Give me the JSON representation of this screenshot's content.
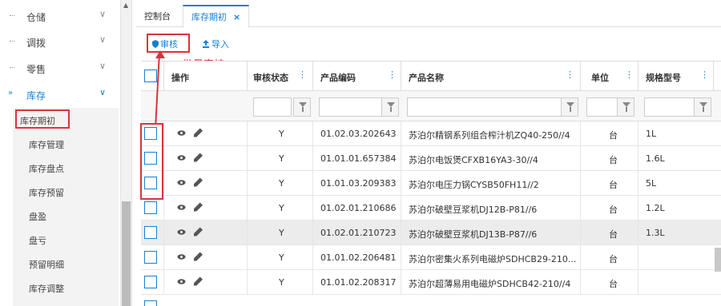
{
  "sidebar": {
    "menu": [
      {
        "label": "仓储",
        "chevron": "∨"
      },
      {
        "label": "调拨",
        "chevron": "∨"
      },
      {
        "label": "零售",
        "chevron": "∨"
      },
      {
        "label": "库存",
        "chevron": "∨",
        "arrow": "»"
      }
    ],
    "submenu": [
      "库存期初",
      "库存管理",
      "库存盘点",
      "库存预留",
      "盘盈",
      "盘亏",
      "预留明细",
      "库存调整"
    ]
  },
  "tabs": {
    "console": "控制台",
    "active": "库存期初",
    "close": "×"
  },
  "toolbar": {
    "audit_label": "审核",
    "import_label": "导入",
    "audit_icon": "shield-icon",
    "import_icon": "upload-icon"
  },
  "annotation": "批量审核",
  "table": {
    "headers": {
      "action": "操作",
      "status": "审核状态",
      "code": "产品编码",
      "name": "产品名称",
      "unit": "单位",
      "spec": "规格型号",
      "dots": "⋮"
    },
    "rows": [
      {
        "status": "Y",
        "code": "01.02.03.202643",
        "name": "苏泊尔精钢系列组合榨汁机ZQ40-250//4",
        "unit": "台",
        "spec": "1L"
      },
      {
        "status": "Y",
        "code": "01.01.01.657384",
        "name": "苏泊尔电饭煲CFXB16YA3-30//4",
        "unit": "台",
        "spec": "1.6L"
      },
      {
        "status": "Y",
        "code": "01.01.03.209383",
        "name": "苏泊尔电压力锅CYSB50FH11//2",
        "unit": "台",
        "spec": "5L"
      },
      {
        "status": "Y",
        "code": "01.02.01.210686",
        "name": "苏泊尔破壁豆浆机DJ12B-P81//6",
        "unit": "台",
        "spec": "1.2L"
      },
      {
        "status": "Y",
        "code": "01.02.01.210723",
        "name": "苏泊尔破壁豆浆机DJ13B-P87//6",
        "unit": "台",
        "spec": "1.3L"
      },
      {
        "status": "Y",
        "code": "01.01.02.206481",
        "name": "苏泊尔密集火系列电磁炉SDHCB29-210...",
        "unit": "台",
        "spec": ""
      },
      {
        "status": "Y",
        "code": "01.01.02.208317",
        "name": "苏泊尔超薄易用电磁炉SDHCB42-210//4",
        "unit": "台",
        "spec": ""
      }
    ]
  },
  "colors": {
    "accent": "#1a7fd1",
    "annotation": "#d9343b"
  }
}
